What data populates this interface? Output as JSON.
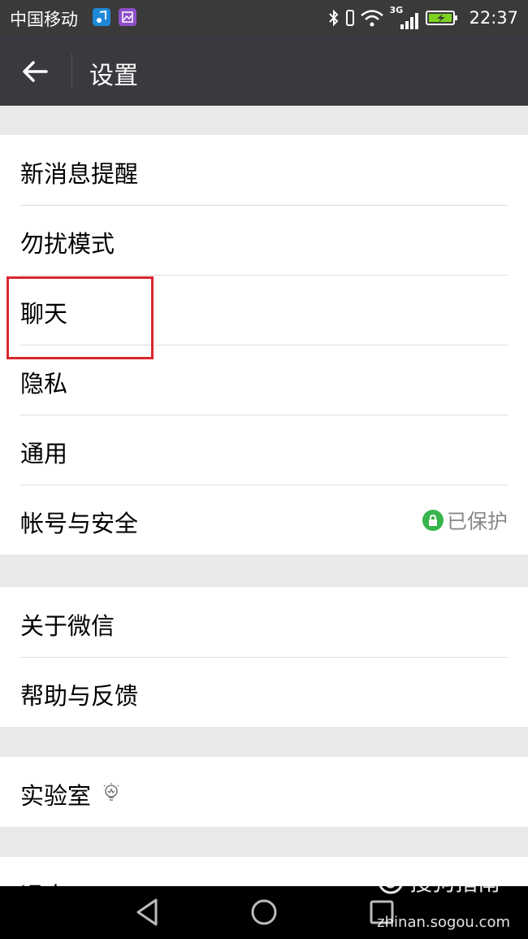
{
  "status_bar": {
    "carrier": "中国移动",
    "network": "3G",
    "time": "22:37"
  },
  "app_bar": {
    "title": "设置"
  },
  "groups": [
    {
      "items": [
        {
          "label": "新消息提醒"
        },
        {
          "label": "勿扰模式"
        },
        {
          "label": "聊天"
        },
        {
          "label": "隐私"
        },
        {
          "label": "通用"
        },
        {
          "label": "帐号与安全",
          "status": "已保护"
        }
      ]
    },
    {
      "items": [
        {
          "label": "关于微信"
        },
        {
          "label": "帮助与反馈"
        }
      ]
    },
    {
      "items": [
        {
          "label": "实验室"
        }
      ]
    },
    {
      "items": [
        {
          "label": "退出"
        }
      ]
    }
  ],
  "watermark": {
    "brand": "搜狗指南",
    "url": "zhinan.sogou.com"
  },
  "colors": {
    "status_bar_bg": "#3a3a3a",
    "app_bar_bg": "#393a3f",
    "page_bg": "#e9e9e9",
    "protected_green": "#37b44a",
    "highlight_red": "#d9272d"
  },
  "icons": {
    "back": "arrow-left-icon",
    "lab": "lightbulb-icon",
    "lock": "lock-icon"
  }
}
